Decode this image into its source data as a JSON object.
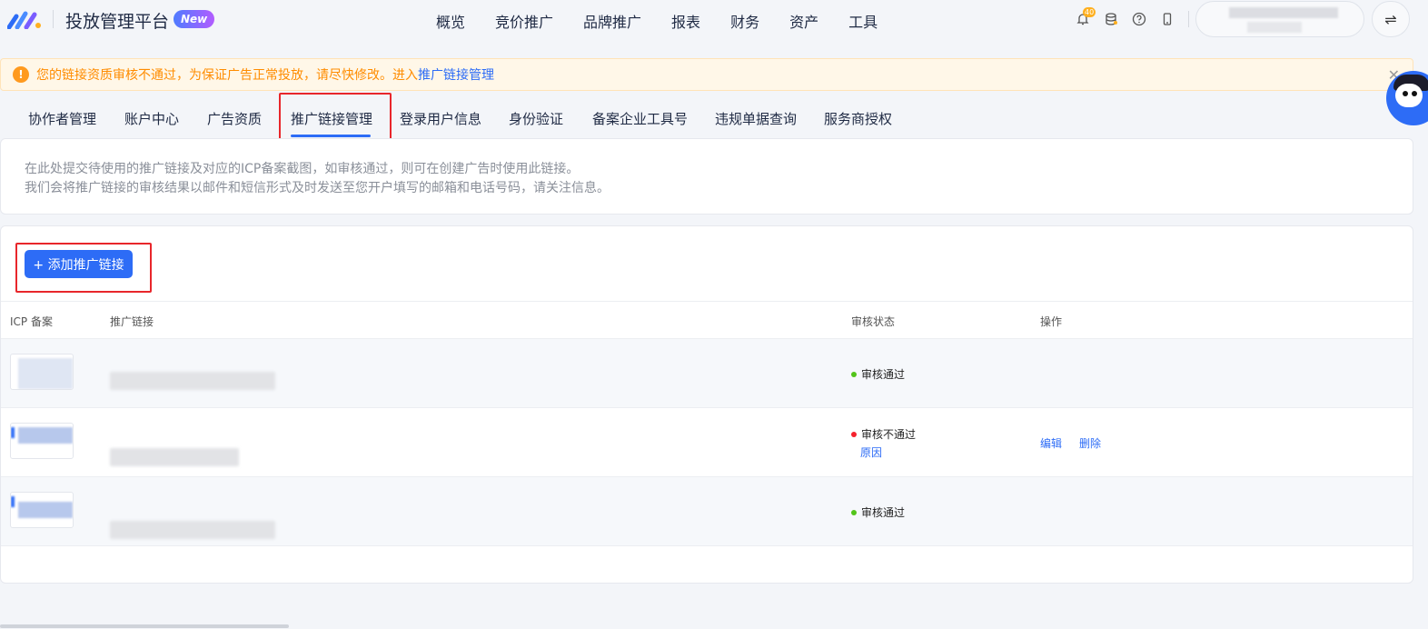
{
  "header": {
    "app_title": "投放管理平台",
    "new_badge": "New",
    "nav": [
      "概览",
      "竞价推广",
      "品牌推广",
      "报表",
      "财务",
      "资产",
      "工具"
    ],
    "notification_count": "40",
    "switch_icon": "⇌"
  },
  "banner": {
    "icon": "!",
    "text": "您的链接资质审核不通过，为保证广告正常投放，请尽快修改。进入",
    "link": "推广链接管理",
    "close": "✕"
  },
  "tabs": [
    "协作者管理",
    "账户中心",
    "广告资质",
    "推广链接管理",
    "登录用户信息",
    "身份验证",
    "备案企业工具号",
    "违规单据查询",
    "服务商授权"
  ],
  "active_tab_index": 3,
  "info": {
    "line1": "在此处提交待使用的推广链接及对应的ICP备案截图，如审核通过，则可在创建广告时使用此链接。",
    "line2": "我们会将推广链接的审核结果以邮件和短信形式及时发送至您开户填写的邮箱和电话号码，请关注信息。"
  },
  "add_button": "+ 添加推广链接",
  "table": {
    "headers": {
      "icp": "ICP 备案",
      "link": "推广链接",
      "status": "审核状态",
      "ops": "操作"
    },
    "rows": [
      {
        "status": "审核通过",
        "status_color": "#52c41a"
      },
      {
        "status": "审核不通过",
        "status_color": "#f5222d",
        "reason": "原因",
        "edit": "编辑",
        "delete": "删除"
      },
      {
        "status": "审核通过",
        "status_color": "#52c41a"
      }
    ]
  },
  "colors": {
    "primary": "#2d6cf6",
    "warning": "#ff8c00",
    "highlight_box": "#e8262b"
  }
}
